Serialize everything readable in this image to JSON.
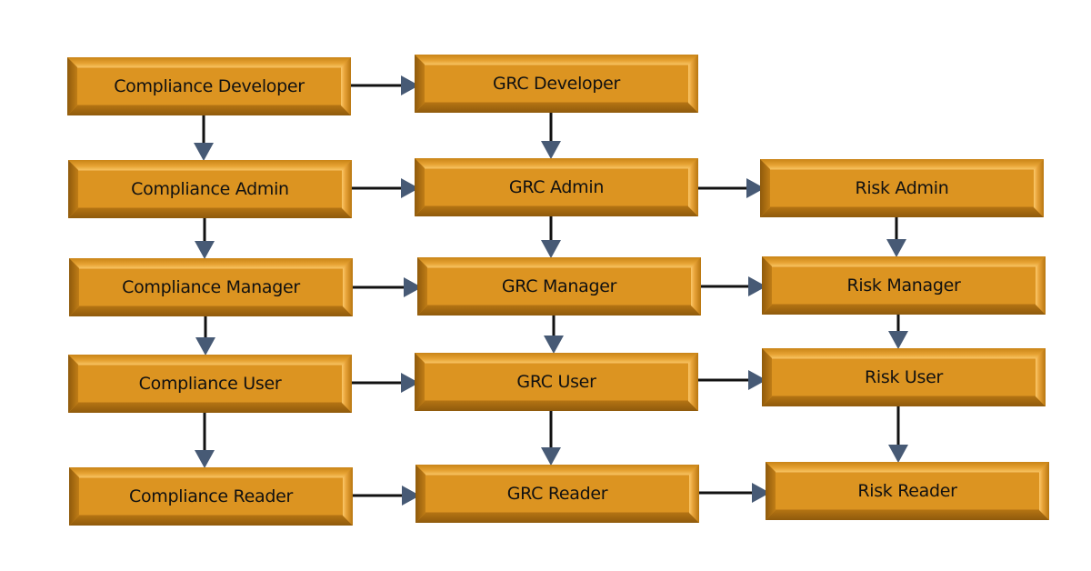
{
  "diagram": {
    "colors": {
      "box_fill": "#dc9421",
      "box_text": "#111111",
      "connector_line": "#111111",
      "arrowhead": "#475a75",
      "background": "#ffffff"
    },
    "columns": [
      {
        "name": "Compliance",
        "roles": [
          {
            "id": "compliance-developer",
            "label": "Compliance Developer"
          },
          {
            "id": "compliance-admin",
            "label": "Compliance Admin"
          },
          {
            "id": "compliance-manager",
            "label": "Compliance Manager"
          },
          {
            "id": "compliance-user",
            "label": "Compliance User"
          },
          {
            "id": "compliance-reader",
            "label": "Compliance Reader"
          }
        ]
      },
      {
        "name": "GRC",
        "roles": [
          {
            "id": "grc-developer",
            "label": "GRC Developer"
          },
          {
            "id": "grc-admin",
            "label": "GRC Admin"
          },
          {
            "id": "grc-manager",
            "label": "GRC Manager"
          },
          {
            "id": "grc-user",
            "label": "GRC User"
          },
          {
            "id": "grc-reader",
            "label": "GRC Reader"
          }
        ]
      },
      {
        "name": "Risk",
        "roles": [
          {
            "id": "risk-admin",
            "label": "Risk Admin"
          },
          {
            "id": "risk-manager",
            "label": "Risk Manager"
          },
          {
            "id": "risk-user",
            "label": "Risk User"
          },
          {
            "id": "risk-reader",
            "label": "Risk Reader"
          }
        ]
      }
    ],
    "edges": [
      {
        "from": "compliance-developer",
        "to": "grc-developer"
      },
      {
        "from": "compliance-developer",
        "to": "compliance-admin"
      },
      {
        "from": "grc-developer",
        "to": "grc-admin"
      },
      {
        "from": "compliance-admin",
        "to": "grc-admin"
      },
      {
        "from": "grc-admin",
        "to": "risk-admin"
      },
      {
        "from": "compliance-admin",
        "to": "compliance-manager"
      },
      {
        "from": "grc-admin",
        "to": "grc-manager"
      },
      {
        "from": "risk-admin",
        "to": "risk-manager"
      },
      {
        "from": "compliance-manager",
        "to": "grc-manager"
      },
      {
        "from": "grc-manager",
        "to": "risk-manager"
      },
      {
        "from": "compliance-manager",
        "to": "compliance-user"
      },
      {
        "from": "grc-manager",
        "to": "grc-user"
      },
      {
        "from": "risk-manager",
        "to": "risk-user"
      },
      {
        "from": "compliance-user",
        "to": "grc-user"
      },
      {
        "from": "grc-user",
        "to": "risk-user"
      },
      {
        "from": "compliance-user",
        "to": "compliance-reader"
      },
      {
        "from": "grc-user",
        "to": "grc-reader"
      },
      {
        "from": "risk-user",
        "to": "risk-reader"
      },
      {
        "from": "compliance-reader",
        "to": "grc-reader"
      },
      {
        "from": "grc-reader",
        "to": "risk-reader"
      }
    ]
  }
}
